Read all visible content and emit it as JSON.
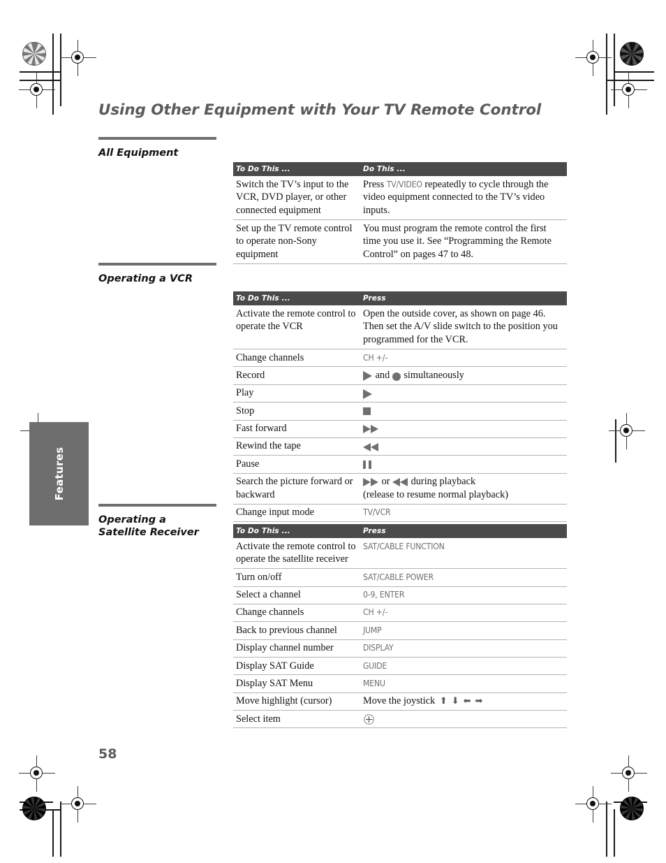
{
  "document": {
    "page_title": "Using Other Equipment with Your TV Remote Control",
    "page_number": "58",
    "side_tab_label": "Features"
  },
  "sections": [
    {
      "heading": "All Equipment",
      "table": {
        "headers": [
          "To Do This ...",
          "Do This ..."
        ],
        "rows": [
          {
            "col_a": "Switch the TV’s input to the VCR, DVD player, or other connected equipment",
            "col_b_prefix": "Press ",
            "col_b_key": "TV/VIDEO",
            "col_b_suffix": " repeatedly to cycle through the video equipment connected to the TV’s video inputs."
          },
          {
            "col_a": "Set up the TV remote control to operate non-Sony equipment",
            "col_b": "You must program the remote control the first time you use it. See “Programming the Remote Control” on pages 47 to 48."
          }
        ]
      }
    },
    {
      "heading": "Operating a VCR",
      "table": {
        "headers": [
          "To Do This ...",
          "Press"
        ],
        "rows": [
          {
            "col_a": "Activate the remote control to operate the VCR",
            "col_b": "Open the outside cover, as shown on page 46. Then set the A/V slide switch to the position you programmed for the VCR."
          },
          {
            "col_a": "Change channels",
            "col_b_key": "CH +/-"
          },
          {
            "col_a": "Record",
            "col_b_icons": "play-icon record-icon",
            "col_b_mid": " and ",
            "col_b_tail": " simultaneously"
          },
          {
            "col_a": "Play",
            "col_b_icons": "play-icon"
          },
          {
            "col_a": "Stop",
            "col_b_icons": "stop-icon"
          },
          {
            "col_a": "Fast forward",
            "col_b_icons": "fast-forward-icon"
          },
          {
            "col_a": "Rewind the tape",
            "col_b_icons": "rewind-icon"
          },
          {
            "col_a": "Pause",
            "col_b_icons": "pause-icon"
          },
          {
            "col_a": "Search the picture forward or backward",
            "col_b_mid": " or ",
            "col_b_tail": " during playback",
            "col_b_line2": "(release to resume normal playback)"
          },
          {
            "col_a": "Change input mode",
            "col_b_key": "TV/VCR"
          }
        ]
      }
    },
    {
      "heading_line1": "Operating a",
      "heading_line2": "Satellite Receiver",
      "table": {
        "headers": [
          "To Do This ...",
          "Press"
        ],
        "rows": [
          {
            "col_a": "Activate the remote control to operate the satellite receiver",
            "col_b_key": "SAT/CABLE FUNCTION"
          },
          {
            "col_a": "Turn on/off",
            "col_b_key": "SAT/CABLE POWER"
          },
          {
            "col_a": "Select a channel",
            "col_b_key": "0-9, ENTER"
          },
          {
            "col_a": "Change channels",
            "col_b_key": "CH +/-"
          },
          {
            "col_a": "Back to previous channel",
            "col_b_key": "JUMP"
          },
          {
            "col_a": "Display channel number",
            "col_b_key": "DISPLAY"
          },
          {
            "col_a": "Display SAT Guide",
            "col_b_key": "GUIDE"
          },
          {
            "col_a": "Display SAT Menu",
            "col_b_key": "MENU"
          },
          {
            "col_a": "Move highlight (cursor)",
            "col_b_prefix": "Move the joystick ",
            "arrows": [
              "⬆",
              "⬇",
              "⬅",
              "➡"
            ]
          },
          {
            "col_a": "Select item",
            "col_b_icons": "joystick-select-icon"
          }
        ]
      }
    }
  ],
  "colors": {
    "title_gray": "#5b5b5b",
    "table_header_bg": "#4a4a4a",
    "side_tab_bg": "#6e6e6e",
    "key_text": "#6f6f6f",
    "rule_gray": "#b4b4b4"
  }
}
